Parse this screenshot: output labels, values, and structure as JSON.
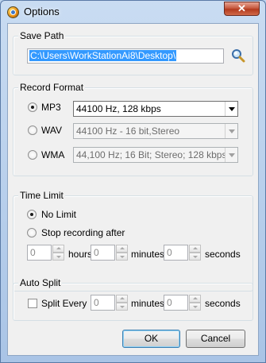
{
  "window": {
    "title": "Options",
    "close_symbol": "✕"
  },
  "save_path": {
    "legend": "Save Path",
    "path_value": "C:\\Users\\WorkStationAi8\\Desktop\\",
    "browse_icon": "magnifier-icon"
  },
  "record_format": {
    "legend": "Record Format",
    "options": [
      {
        "label": "MP3",
        "selected": true,
        "quality": "44100 Hz, 128 kbps",
        "enabled": true
      },
      {
        "label": "WAV",
        "selected": false,
        "quality": "44100 Hz - 16 bit,Stereo",
        "enabled": false
      },
      {
        "label": "WMA",
        "selected": false,
        "quality": "44,100 Hz; 16 Bit; Stereo; 128 kbps;",
        "enabled": false
      }
    ]
  },
  "time_limit": {
    "legend": "Time Limit",
    "no_limit_label": "No Limit",
    "stop_after_label": "Stop recording after",
    "selected": "No Limit",
    "hours_value": "0",
    "hours_label": "hours",
    "minutes_value": "0",
    "minutes_label": "minutes",
    "seconds_value": "0",
    "seconds_label": "seconds"
  },
  "auto_split": {
    "legend": "Auto Split",
    "split_every_label": "Split Every",
    "checked": false,
    "minutes_value": "0",
    "minutes_label": "minutes",
    "seconds_value": "0",
    "seconds_label": "seconds"
  },
  "buttons": {
    "ok": "OK",
    "cancel": "Cancel"
  }
}
